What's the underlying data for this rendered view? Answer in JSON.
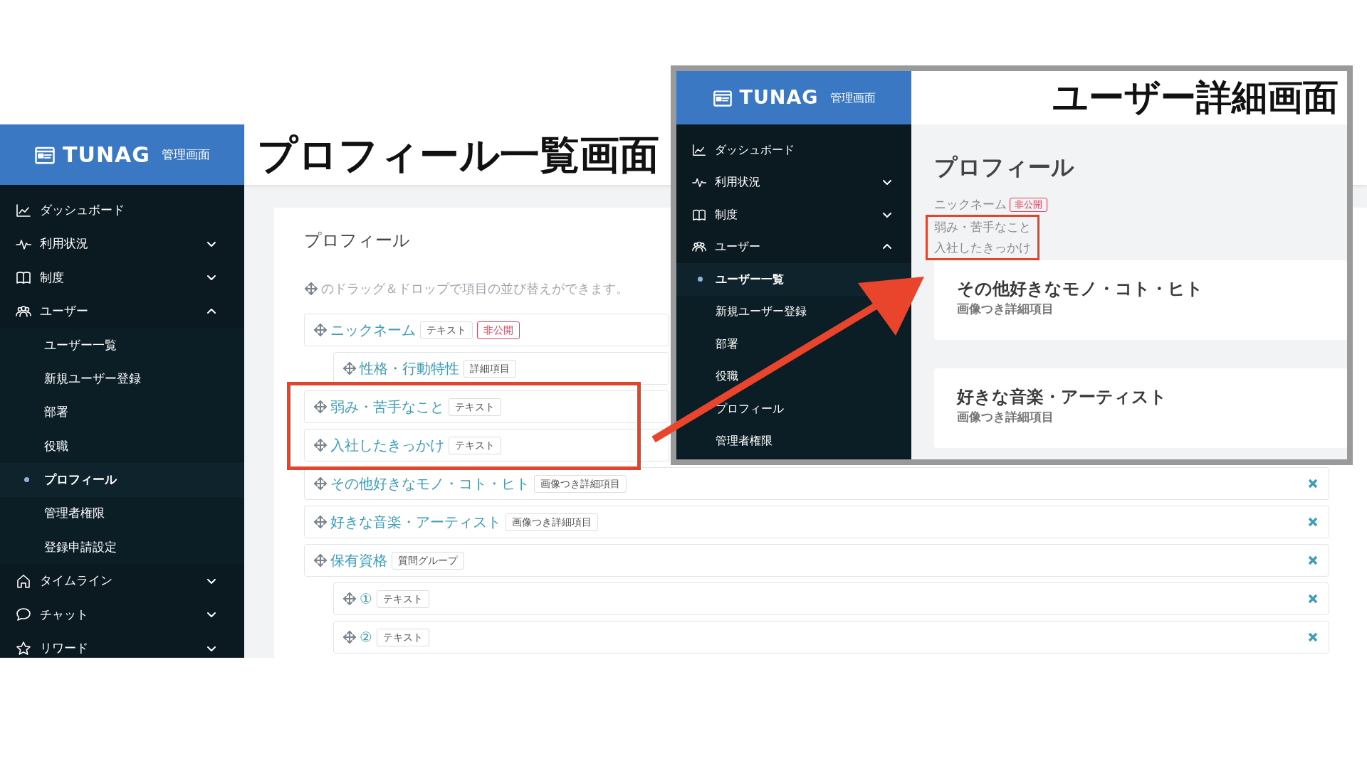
{
  "list_view": {
    "brand": "TUNAG",
    "brand_sub": "管理画面",
    "caption": "プロフィール一覧画面",
    "sidebar": [
      {
        "kind": "link",
        "label": "ダッシュボード"
      },
      {
        "kind": "group",
        "label": "利用状況",
        "expanded": false
      },
      {
        "kind": "group",
        "label": "制度",
        "expanded": false
      },
      {
        "kind": "group",
        "label": "ユーザー",
        "expanded": true,
        "children": [
          {
            "label": "ユーザー一覧",
            "selected": false
          },
          {
            "label": "新規ユーザー登録",
            "selected": false
          },
          {
            "label": "部署",
            "selected": false
          },
          {
            "label": "役職",
            "selected": false
          },
          {
            "label": "プロフィール",
            "selected": true
          },
          {
            "label": "管理者権限",
            "selected": false
          },
          {
            "label": "登録申請設定",
            "selected": false
          }
        ]
      },
      {
        "kind": "group",
        "label": "タイムライン",
        "expanded": false
      },
      {
        "kind": "group",
        "label": "チャット",
        "expanded": false
      },
      {
        "kind": "group",
        "label": "リワード",
        "expanded": false
      }
    ],
    "card": {
      "title": "プロフィール",
      "hint": "のドラッグ＆ドロップで項目の並び替えができます。",
      "items": [
        {
          "label": "ニックネーム",
          "tag": "テキスト",
          "private_tag": "非公開",
          "highlighted": false,
          "children": [
            {
              "label": "性格・行動特性",
              "tag": "詳細項目",
              "highlighted": false
            }
          ]
        },
        {
          "label": "弱み・苦手なこと",
          "tag": "テキスト",
          "highlighted": true
        },
        {
          "label": "入社したきっかけ",
          "tag": "テキスト",
          "highlighted": true
        },
        {
          "label": "その他好きなモノ・コト・ヒト",
          "tag": "画像つき詳細項目",
          "highlighted": false
        },
        {
          "label": "好きな音楽・アーティスト",
          "tag": "画像つき詳細項目",
          "highlighted": false
        },
        {
          "label": "保有資格",
          "tag": "質問グループ",
          "highlighted": false,
          "children": [
            {
              "label": "①",
              "tag": "テキスト",
              "highlighted": false
            },
            {
              "label": "②",
              "tag": "テキスト",
              "highlighted": false
            }
          ]
        }
      ]
    }
  },
  "detail_view": {
    "brand": "TUNAG",
    "brand_sub": "管理画面",
    "caption": "ユーザー詳細画面",
    "sidebar": [
      {
        "kind": "link",
        "label": "ダッシュボード"
      },
      {
        "kind": "group",
        "label": "利用状況",
        "expanded": false
      },
      {
        "kind": "group",
        "label": "制度",
        "expanded": false
      },
      {
        "kind": "group",
        "label": "ユーザー",
        "expanded": true,
        "children": [
          {
            "label": "ユーザー一覧",
            "selected": true
          },
          {
            "label": "新規ユーザー登録",
            "selected": false
          },
          {
            "label": "部署",
            "selected": false
          },
          {
            "label": "役職",
            "selected": false
          },
          {
            "label": "プロフィール",
            "selected": false
          },
          {
            "label": "管理者権限",
            "selected": false
          }
        ]
      }
    ],
    "title": "プロフィール",
    "fields": [
      {
        "label": "ニックネーム",
        "private_tag": "非公開",
        "highlighted": false
      },
      {
        "label": "弱み・苦手なこと",
        "highlighted": true
      },
      {
        "label": "入社したきっかけ",
        "highlighted": true
      }
    ],
    "cards": [
      {
        "title": "その他好きなモノ・コト・ヒト",
        "subtitle": "画像つき詳細項目"
      },
      {
        "title": "好きな音楽・アーティスト",
        "subtitle": "画像つき詳細項目"
      }
    ]
  }
}
